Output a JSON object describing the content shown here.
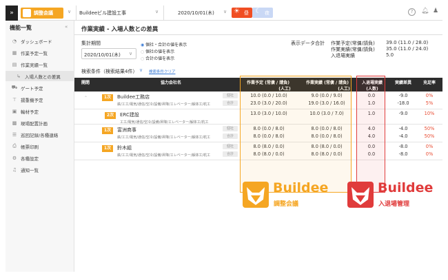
{
  "topbar": {
    "menu_icon": "»",
    "logo_text": "調整会議",
    "company_select": "Buildeeビル建設工事",
    "date_select": "2020/10/01(木)",
    "day_badge": "昼",
    "night_badge": "夜"
  },
  "sidebar": {
    "title": "機能一覧",
    "items": [
      {
        "label": "ダッシュボード",
        "icon": "gauge-icon"
      },
      {
        "label": "作業予定一覧",
        "icon": "calendar-icon"
      },
      {
        "label": "作業実績一覧",
        "icon": "clipboard-icon"
      },
      {
        "label": "入場人数との差異",
        "icon": "diff-icon"
      },
      {
        "label": "ゲート予定",
        "icon": "truck-icon"
      },
      {
        "label": "揚重機予定",
        "icon": "crane-icon"
      },
      {
        "label": "輸材予定",
        "icon": "package-icon"
      },
      {
        "label": "現場配置計画",
        "icon": "layout-icon"
      },
      {
        "label": "巡回記録/各種連絡",
        "icon": "patrol-icon"
      },
      {
        "label": "帳票印刷",
        "icon": "printer-icon"
      },
      {
        "label": "各種設定",
        "icon": "gear-icon"
      },
      {
        "label": "通知一覧",
        "icon": "bell-icon"
      }
    ]
  },
  "page": {
    "title": "作業実績 - 入場人数との差異",
    "period_label": "集計期間",
    "period_value": "2020/10/01(木)",
    "radio_options": [
      "個社・合計の値を表示",
      "個社の値を表示",
      "合計の値を表示"
    ],
    "search_condition": "検索条件（検索結果4件）",
    "clear_link": "検索条件クリア",
    "summary_label": "表示データ合計",
    "summary_rows": [
      {
        "k": "作業予定(常傭/請負)",
        "v": "39.0 (11.0 / 28.0)"
      },
      {
        "k": "作業実績(常傭/請負)",
        "v": "35.0 (11.0 / 24.0)"
      },
      {
        "k": "入退場実績",
        "v": "5.0"
      }
    ]
  },
  "table": {
    "headers": {
      "open": "開閉",
      "company": "協力会社名",
      "plan": "作業予定 (常傭 / 請負)",
      "plan_unit": "(人工)",
      "actual": "作業実績 (常傭 / 請負)",
      "actual_unit": "(人工)",
      "entry": "入退場実績",
      "entry_unit": "(人数)",
      "diff": "実績差異",
      "rate": "充足率"
    },
    "rows": [
      {
        "tier": "1次",
        "name": "Buildee工務店",
        "trades": "鉄/エ工/電気/通信/空冷/設備/昇降/エレベーター/解体工/杭工",
        "lines": [
          {
            "tag": "個社",
            "plan": "10.0 (0.0 / 10.0)",
            "actual": "9.0 (0.0 / 9.0)",
            "entry": "0.0",
            "diff": "-9.0",
            "rate": "0%"
          },
          {
            "tag": "合計",
            "plan": "23.0 (3.0 / 20.0)",
            "actual": "19.0 (3.0 / 16.0)",
            "entry": "1.0",
            "diff": "-18.0",
            "rate": "5%"
          }
        ]
      },
      {
        "tier": "2次",
        "name": "ERC建設",
        "trades": "エ工/電気/通信/空冷/設備/昇降/エレベーター/解体工/杭工",
        "lines": [
          {
            "tag": "",
            "plan": "13.0 (3.0 / 10.0)",
            "actual": "10.0 (3.0 / 7.0)",
            "entry": "1.0",
            "diff": "-9.0",
            "rate": "10%"
          }
        ]
      },
      {
        "tier": "1次",
        "name": "富洲商事",
        "trades": "鉄/エ工/電気/通信/空冷/設備/昇降/エレベーター/解体工/杭工",
        "lines": [
          {
            "tag": "個社",
            "plan": "8.0 (0.0 / 8.0)",
            "actual": "8.0 (0.0 / 8.0)",
            "entry": "4.0",
            "diff": "-4.0",
            "rate": "50%"
          },
          {
            "tag": "合計",
            "plan": "8.0 (0.0 / 8.0)",
            "actual": "8.0 (0.0 / 8.0)",
            "entry": "4.0",
            "diff": "-4.0",
            "rate": "50%"
          }
        ]
      },
      {
        "tier": "1次",
        "name": "鈴木組",
        "trades": "鉄/エ工/電気/通信/空冷/設備/昇降/エレベーター/解体工/杭工",
        "lines": [
          {
            "tag": "個社",
            "plan": "8.0 (8.0 / 0.0)",
            "actual": "8.0 (8.0 / 0.0)",
            "entry": "0.0",
            "diff": "-8.0",
            "rate": "0%"
          },
          {
            "tag": "合計",
            "plan": "8.0 (8.0 / 0.0)",
            "actual": "8.0 (8.0 / 0.0)",
            "entry": "0.0",
            "diff": "-8.0",
            "rate": "0%"
          }
        ]
      }
    ]
  },
  "logos": {
    "left_name": "Buildee",
    "left_sub": "調整会議",
    "right_name": "Buildee",
    "right_sub": "入退場管理"
  },
  "colors": {
    "orange_outline": "#f5a623",
    "red_outline": "#e03b3b",
    "plan_bg": "#fdf3e1",
    "entry_bg": "#fce8e8",
    "header_bg": "#2d2d2d"
  }
}
